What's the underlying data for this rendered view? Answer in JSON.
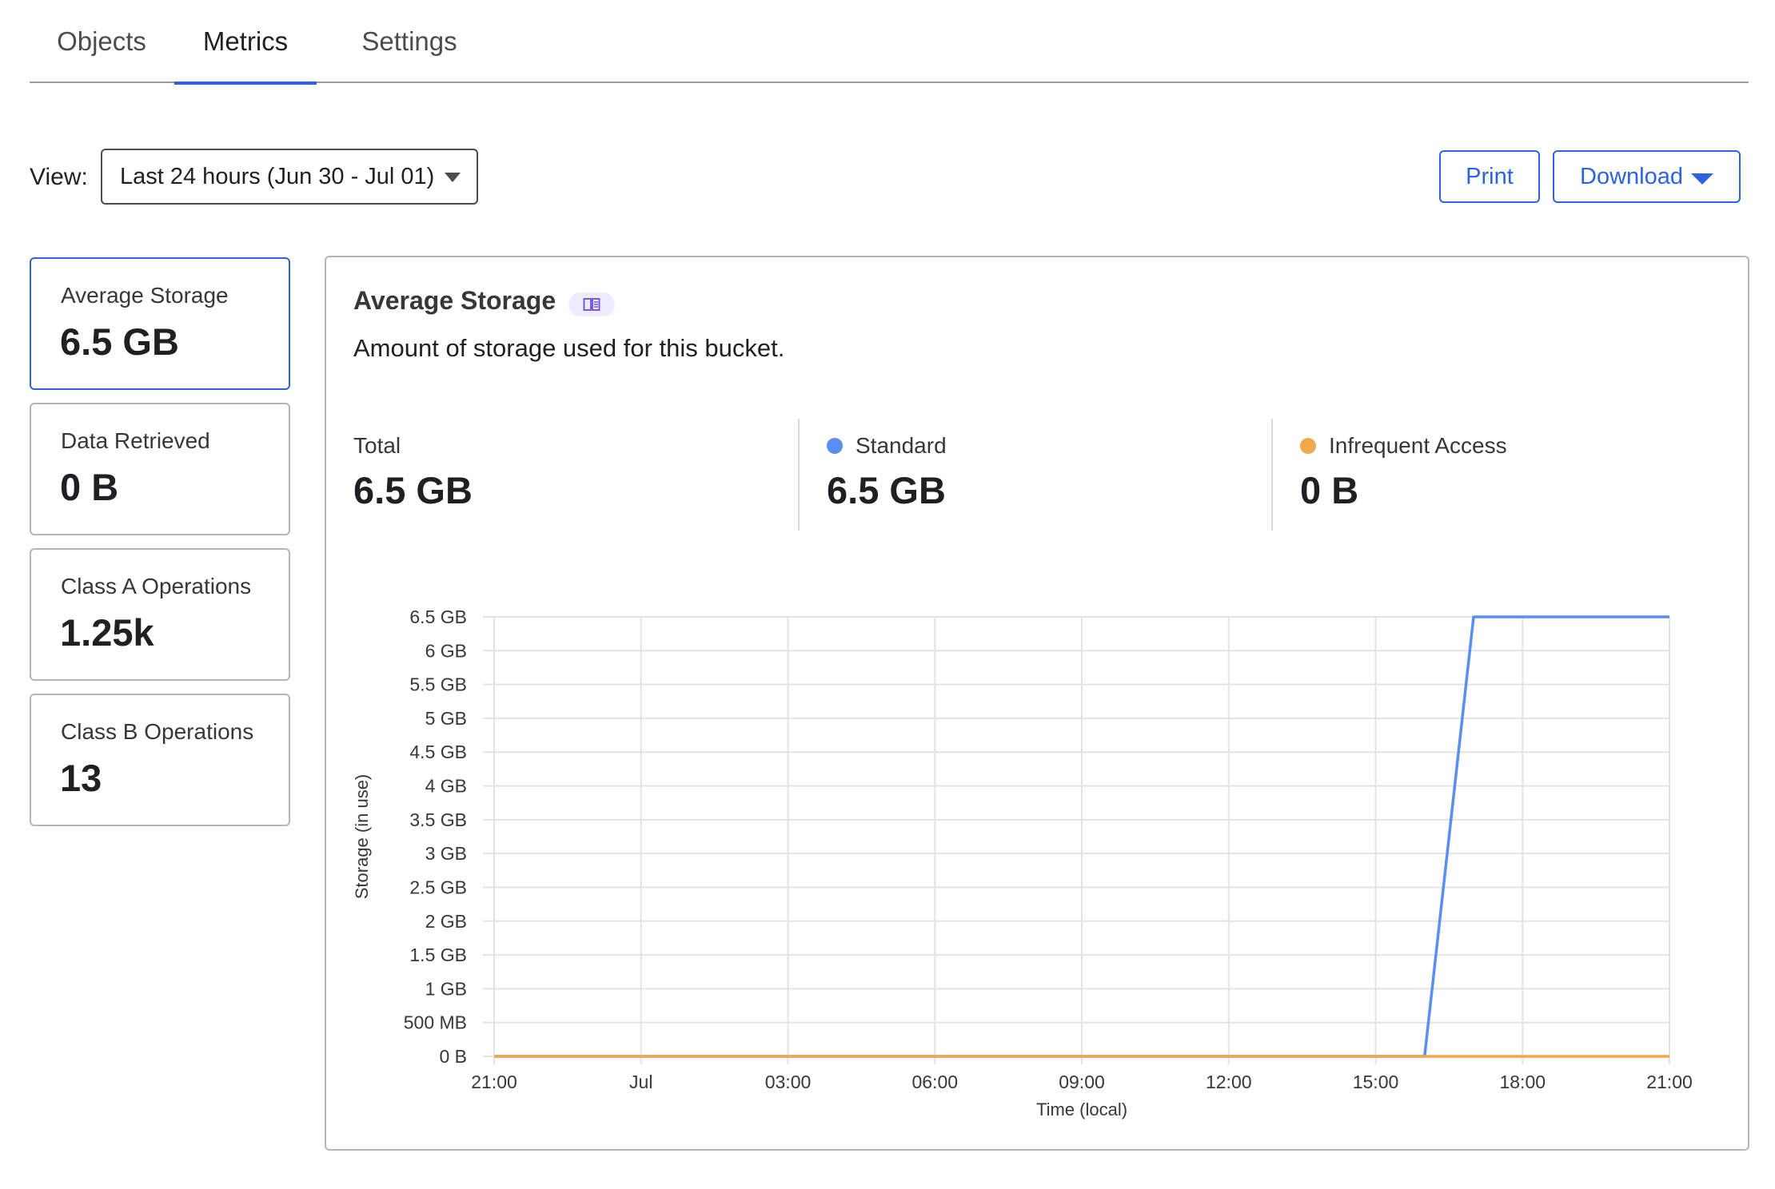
{
  "tabs": [
    {
      "label": "Objects",
      "active": false
    },
    {
      "label": "Metrics",
      "active": true
    },
    {
      "label": "Settings",
      "active": false
    }
  ],
  "view": {
    "label": "View:",
    "selected": "Last 24 hours (Jun 30 - Jul 01)"
  },
  "actions": {
    "print_label": "Print",
    "download_label": "Download"
  },
  "cards": [
    {
      "label": "Average Storage",
      "value": "6.5 GB",
      "active": true
    },
    {
      "label": "Data Retrieved",
      "value": "0 B",
      "active": false
    },
    {
      "label": "Class A Operations",
      "value": "1.25k",
      "active": false
    },
    {
      "label": "Class B Operations",
      "value": "13",
      "active": false
    }
  ],
  "panel": {
    "title": "Average Storage",
    "description": "Amount of storage used for this bucket.",
    "stats": [
      {
        "label": "Total",
        "value": "6.5 GB",
        "color": null
      },
      {
        "label": "Standard",
        "value": "6.5 GB",
        "color": "#5a8ef0"
      },
      {
        "label": "Infrequent Access",
        "value": "0 B",
        "color": "#f0a84a"
      }
    ]
  },
  "colors": {
    "accent": "#2d63e1",
    "standard": "#5a8ef0",
    "infrequent": "#f0a84a"
  },
  "chart_data": {
    "type": "line",
    "xlabel": "Time (local)",
    "ylabel": "Storage (in use)",
    "x_ticks": [
      "21:00",
      "Jul",
      "03:00",
      "06:00",
      "09:00",
      "12:00",
      "15:00",
      "18:00",
      "21:00"
    ],
    "x_range_hours": [
      0,
      24
    ],
    "y_ticks": [
      "0 B",
      "500 MB",
      "1 GB",
      "1.5 GB",
      "2 GB",
      "2.5 GB",
      "3 GB",
      "3.5 GB",
      "4 GB",
      "4.5 GB",
      "5 GB",
      "5.5 GB",
      "6 GB",
      "6.5 GB"
    ],
    "ylim_gb": [
      0,
      6.5
    ],
    "grid": true,
    "series": [
      {
        "name": "Standard",
        "color": "#5a8ef0",
        "x_hours": [
          0,
          19,
          20,
          24
        ],
        "y_gb": [
          0,
          0,
          6.5,
          6.5
        ]
      },
      {
        "name": "Infrequent Access",
        "color": "#f0a84a",
        "x_hours": [
          0,
          24
        ],
        "y_gb": [
          0,
          0
        ]
      }
    ]
  }
}
